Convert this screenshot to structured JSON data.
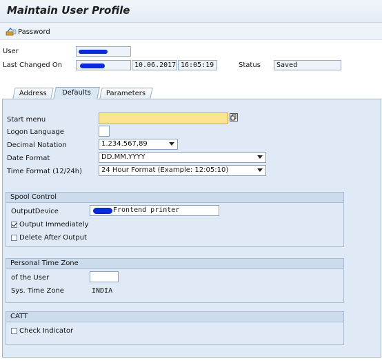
{
  "window": {
    "title": "Maintain User Profile"
  },
  "toolbar": {
    "password_label": "Password"
  },
  "header": {
    "user_label": "User",
    "last_changed_label": "Last Changed On",
    "last_changed_date": "10.06.2017",
    "last_changed_time": "16:05:19",
    "status_label": "Status",
    "status_value": "Saved"
  },
  "tabs": [
    {
      "label": "Address",
      "active": false
    },
    {
      "label": "Defaults",
      "active": true
    },
    {
      "label": "Parameters",
      "active": false
    }
  ],
  "defaults": {
    "start_menu_label": "Start menu",
    "start_menu_value": "",
    "logon_language_label": "Logon Language",
    "logon_language_value": "",
    "decimal_notation_label": "Decimal Notation",
    "decimal_notation_value": "1.234.567,89",
    "date_format_label": "Date Format",
    "date_format_value": "DD.MM.YYYY",
    "time_format_label": "Time Format (12/24h)",
    "time_format_value": "24 Hour Format (Example: 12:05:10)"
  },
  "spool": {
    "title": "Spool Control",
    "output_device_label": "OutputDevice",
    "output_device_value": "Frontend printer",
    "output_immediately_label": "Output Immediately",
    "output_immediately_checked": true,
    "delete_after_label": "Delete After Output",
    "delete_after_checked": false
  },
  "timezone": {
    "title": "Personal Time Zone",
    "user_label": "of the User",
    "user_value": "",
    "sys_label": "Sys. Time Zone",
    "sys_value": "INDIA"
  },
  "catt": {
    "title": "CATT",
    "check_indicator_label": "Check Indicator",
    "check_indicator_checked": false
  },
  "colors": {
    "panel": "#dfeaf6",
    "accent_field": "#fbe48f",
    "redaction": "#0a2ad8"
  }
}
